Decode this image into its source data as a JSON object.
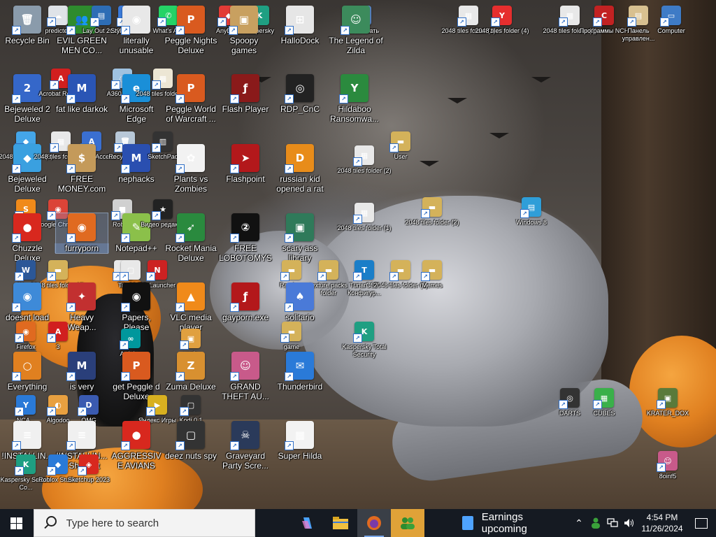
{
  "desktop": {
    "icons": [
      {
        "label": "2048 tiles",
        "small": true,
        "color": "#b0b8c0",
        "glyph": "▦"
      },
      {
        "label": "Recycle Bin",
        "small": false,
        "color": "#8a9bab",
        "glyph": "🗑"
      },
      {
        "label": "predicted",
        "small": true,
        "color": "#dfe3e8",
        "glyph": "☁"
      },
      {
        "label": "EVIL GREEN MEN CO...",
        "small": false,
        "color": "#2e8b2e",
        "glyph": "👥"
      },
      {
        "label": "Lay Out 2023",
        "small": true,
        "color": "#2d6db5",
        "glyph": "▤"
      },
      {
        "label": "Style Border",
        "small": true,
        "color": "#3a7ad9",
        "glyph": "◰"
      },
      {
        "label": "literally unusable",
        "small": false,
        "color": "#e8e8e8",
        "glyph": "◉"
      },
      {
        "label": "What's App",
        "small": true,
        "color": "#25d366",
        "glyph": "✆"
      },
      {
        "label": "Peggle Nights Deluxe",
        "small": false,
        "color": "#d95a1f",
        "glyph": "P"
      },
      {
        "label": "AnyDesk",
        "small": true,
        "color": "#e23b36",
        "glyph": "◆"
      },
      {
        "label": "Kaspersky",
        "small": true,
        "color": "#1f9f82",
        "glyph": "K"
      },
      {
        "label": "Spoopy games",
        "small": false,
        "color": "#c8a060",
        "glyph": "▣"
      },
      {
        "label": "HalloDock",
        "small": false,
        "color": "#e6e6e6",
        "glyph": "⊞"
      },
      {
        "label": "растягивать",
        "small": true,
        "color": "#5d8fd1",
        "glyph": "↔"
      },
      {
        "label": "The Legend of Zilda",
        "small": false,
        "color": "#3c8b5c",
        "glyph": "☺"
      },
      {
        "label": "2048 tiles folder (3)",
        "small": true,
        "color": "#e8e8e8",
        "glyph": "▦"
      },
      {
        "label": "2048 tiles folder (4)",
        "small": true,
        "color": "#e62e2e",
        "glyph": "Y"
      },
      {
        "label": "2048 tiles folder (2)",
        "small": true,
        "color": "#e8e8e8",
        "glyph": "▦"
      },
      {
        "label": "Программы NCH",
        "small": true,
        "color": "#c22222",
        "glyph": "C"
      },
      {
        "label": "Панель управлен...",
        "small": true,
        "color": "#d8c090",
        "glyph": "▤"
      },
      {
        "label": "Computer",
        "small": true,
        "color": "#3e7bc6",
        "glyph": "▭"
      },
      {
        "label": "Bejeweled 2 Deluxe",
        "small": false,
        "color": "#3567c9",
        "glyph": "2"
      },
      {
        "label": "Acrobat Reader",
        "small": true,
        "color": "#d11f1f",
        "glyph": "A"
      },
      {
        "label": "fat like darkok",
        "small": false,
        "color": "#2a55b5",
        "glyph": "M"
      },
      {
        "label": "A360 Drive",
        "small": true,
        "color": "#9fc2e0",
        "glyph": "◌"
      },
      {
        "label": "Microsoft Edge",
        "small": false,
        "color": "#1a8fd8",
        "glyph": "e"
      },
      {
        "label": "2048 tiles folder (1)",
        "small": true,
        "color": "#ece6d4",
        "glyph": "▦"
      },
      {
        "label": "Peggle World of Warcraft ...",
        "small": false,
        "color": "#d95a1f",
        "glyph": "P"
      },
      {
        "label": "Flash Player",
        "small": false,
        "color": "#8a1a1a",
        "glyph": "ƒ"
      },
      {
        "label": "RDP_CnC",
        "small": false,
        "color": "#222222",
        "glyph": "◎"
      },
      {
        "label": "Hildaboo Ransomwa...",
        "small": false,
        "color": "#2b8a3e",
        "glyph": "Y"
      },
      {
        "label": "2048 tiles folder (6)",
        "small": true,
        "color": "#44a5e8",
        "glyph": "◆"
      },
      {
        "label": "Bejeweled Deluxe",
        "small": false,
        "color": "#3aa0e0",
        "glyph": "◆"
      },
      {
        "label": "2048 tiles folder (1)",
        "small": true,
        "color": "#e8e8e8",
        "glyph": "▦"
      },
      {
        "label": "Autodesk Access",
        "small": true,
        "color": "#3a6fd0",
        "glyph": "A"
      },
      {
        "label": "FREE MONEY.com",
        "small": false,
        "color": "#c49a5a",
        "glyph": "$"
      },
      {
        "label": "Recycle Bin",
        "small": true,
        "color": "#b8c8d8",
        "glyph": "🗑"
      },
      {
        "label": "nephacks",
        "small": false,
        "color": "#2a4fb0",
        "glyph": "M"
      },
      {
        "label": "SketchPad",
        "small": true,
        "color": "#333",
        "glyph": "▥"
      },
      {
        "label": "Plants vs Zombies",
        "small": false,
        "color": "#f2f2f2",
        "glyph": "✿"
      },
      {
        "label": "Flashpoint",
        "small": false,
        "color": "#b3181b",
        "glyph": "➤"
      },
      {
        "label": "russian kid opened a rat",
        "small": false,
        "color": "#e88c1a",
        "glyph": "D"
      },
      {
        "label": "2048 tiles folder (2)",
        "small": true,
        "color": "#e8e8e8",
        "glyph": "▦"
      },
      {
        "label": "User",
        "small": true,
        "color": "#d4b25a",
        "glyph": "▬"
      },
      {
        "label": "Scratch",
        "small": true,
        "color": "#f08a1a",
        "glyph": "S"
      },
      {
        "label": "Google Chrome",
        "small": true,
        "color": "#db4437",
        "glyph": "◉"
      },
      {
        "label": "Chuzzle Deluxe",
        "small": false,
        "color": "#d8281e",
        "glyph": "●"
      },
      {
        "label": "furryporn",
        "small": false,
        "color": "#e06a20",
        "glyph": "◉"
      },
      {
        "label": "Roblox",
        "small": true,
        "color": "#d0d0d0",
        "glyph": "■"
      },
      {
        "label": "Notepad++",
        "small": false,
        "color": "#8bc04a",
        "glyph": "✎"
      },
      {
        "label": "Видео редакт...",
        "small": true,
        "color": "#222",
        "glyph": "★"
      },
      {
        "label": "Rocket Mania Deluxe",
        "small": false,
        "color": "#2a8a3e",
        "glyph": "➶"
      },
      {
        "label": "FREE LOBOTOMYS",
        "small": false,
        "color": "#111",
        "glyph": "②"
      },
      {
        "label": "scary ass library",
        "small": false,
        "color": "#2f7a5a",
        "glyph": "▣"
      },
      {
        "label": "2048 tiles folder (1)",
        "small": true,
        "color": "#e8e8e8",
        "glyph": "▦"
      },
      {
        "label": "2048 tiles folder (2)",
        "small": true,
        "color": "#d4b25a",
        "glyph": "▬"
      },
      {
        "label": "Windows 8",
        "small": true,
        "color": "#2f9ed8",
        "glyph": "▤"
      },
      {
        "label": "Word",
        "small": true,
        "color": "#2b5797",
        "glyph": "W"
      },
      {
        "label": "2048 tiles folder (4)",
        "small": true,
        "color": "#d4b25a",
        "glyph": "▬"
      },
      {
        "label": "Tile",
        "small": true,
        "color": "#e8e8e8",
        "glyph": "▢"
      },
      {
        "label": "Tile 2048",
        "small": true,
        "color": "#e8e8e8",
        "glyph": "▢"
      },
      {
        "label": "RP Launcher",
        "small": true,
        "color": "#c22",
        "glyph": "N"
      },
      {
        "label": "Random",
        "small": true,
        "color": "#d4b25a",
        "glyph": "▬"
      },
      {
        "label": "texture packs folder",
        "small": true,
        "color": "#d4b25a",
        "glyph": "▬"
      },
      {
        "label": "TunarCSP Конфигур...",
        "small": true,
        "color": "#1a7ec8",
        "glyph": "T"
      },
      {
        "label": "2048 tiles folder (3)",
        "small": true,
        "color": "#d4b25a",
        "glyph": "▬"
      },
      {
        "label": "Memes",
        "small": true,
        "color": "#d4b25a",
        "glyph": "▬"
      },
      {
        "label": "doesnt load",
        "small": false,
        "color": "#3e8ad8",
        "glyph": "◉"
      },
      {
        "label": "Heavy Weap...",
        "small": false,
        "color": "#c23030",
        "glyph": "✦"
      },
      {
        "label": "Papers, Please",
        "small": false,
        "color": "#111",
        "glyph": "◉"
      },
      {
        "label": "VLC media player",
        "small": false,
        "color": "#f08a1a",
        "glyph": "▲"
      },
      {
        "label": "gayporn.exe",
        "small": false,
        "color": "#b3181b",
        "glyph": "ƒ"
      },
      {
        "label": "solitario",
        "small": false,
        "color": "#4a7ad8",
        "glyph": "♠"
      },
      {
        "label": "Firefox",
        "small": true,
        "color": "#e06a20",
        "glyph": "◉"
      },
      {
        "label": "3",
        "small": true,
        "color": "#d11f1f",
        "glyph": "A"
      },
      {
        "label": "Arduino",
        "small": true,
        "color": "#00979c",
        "glyph": "∞"
      },
      {
        "label": "unzip",
        "small": true,
        "color": "#e0a040",
        "glyph": "▣"
      },
      {
        "label": "game",
        "small": true,
        "color": "#d4b25a",
        "glyph": "▬"
      },
      {
        "label": "Kaspersky Total Security",
        "small": true,
        "color": "#1f9f82",
        "glyph": "K"
      },
      {
        "label": "Everything",
        "small": false,
        "color": "#e08020",
        "glyph": "○"
      },
      {
        "label": "is very",
        "small": false,
        "color": "#2a3f7a",
        "glyph": "M"
      },
      {
        "label": "get Peggle d Deluxe",
        "small": false,
        "color": "#d95a1f",
        "glyph": "P"
      },
      {
        "label": "Zuma Deluxe",
        "small": false,
        "color": "#d89030",
        "glyph": "Z"
      },
      {
        "label": "GRAND THEFT AU...",
        "small": false,
        "color": "#c85a8a",
        "glyph": "☺"
      },
      {
        "label": "Thunderbird",
        "small": false,
        "color": "#2a7ad8",
        "glyph": "✉"
      },
      {
        "label": "DARTS",
        "small": true,
        "color": "#333",
        "glyph": "◎"
      },
      {
        "label": "CUBES",
        "small": true,
        "color": "#3ab04a",
        "glyph": "▦"
      },
      {
        "label": "NCA...",
        "small": true,
        "color": "#2a7ad8",
        "glyph": "Y"
      },
      {
        "label": "Algodoo",
        "small": true,
        "color": "#e8a040",
        "glyph": "◐"
      },
      {
        "label": "OMG",
        "small": true,
        "color": "#3a5ab0",
        "glyph": "D"
      },
      {
        "label": "Яндекс Игры",
        "small": true,
        "color": "#d8b020",
        "glyph": "▶"
      },
      {
        "label": "Kodi 0.1",
        "small": true,
        "color": "#333",
        "glyph": "▢"
      },
      {
        "label": "KRATER_DOX",
        "small": true,
        "color": "#5a7a3a",
        "glyph": "▣"
      },
      {
        "label": "!INSTALLIN...",
        "small": false,
        "color": "#f0f0f0",
        "glyph": "≡"
      },
      {
        "label": "!INSTALLIN... - Shortcut",
        "small": false,
        "color": "#f0f0f0",
        "glyph": "≡"
      },
      {
        "label": "AGGRESSIVE AVIANS",
        "small": false,
        "color": "#d8281e",
        "glyph": "●"
      },
      {
        "label": "deez nuts spy",
        "small": false,
        "color": "#333",
        "glyph": "▢"
      },
      {
        "label": "Graveyard Party Scre...",
        "small": false,
        "color": "#2a3a5a",
        "glyph": "☠"
      },
      {
        "label": "Super Hilda",
        "small": false,
        "color": "#f2f2f2",
        "glyph": "▦"
      },
      {
        "label": "8oinf5",
        "small": true,
        "color": "#c85a8a",
        "glyph": "☺"
      },
      {
        "label": "Kaspersky Secure Co...",
        "small": true,
        "color": "#1f9f82",
        "glyph": "K"
      },
      {
        "label": "Roblox Studio",
        "small": true,
        "color": "#2a7ad8",
        "glyph": "◆"
      },
      {
        "label": "Sketchup 2023",
        "small": true,
        "color": "#d8281e",
        "glyph": "◈"
      }
    ]
  },
  "taskbar": {
    "search_placeholder": "Type here to search",
    "news_text": "Earnings upcoming",
    "time": "4:54 PM",
    "date": "11/26/2024",
    "apps": [
      {
        "name": "copilot",
        "color": "#5fa8ff"
      },
      {
        "name": "file-explorer",
        "color": "#f0c040"
      },
      {
        "name": "firefox",
        "color": "#e06a20"
      },
      {
        "name": "evil-green-men",
        "color": "#2e8b2e"
      }
    ]
  }
}
